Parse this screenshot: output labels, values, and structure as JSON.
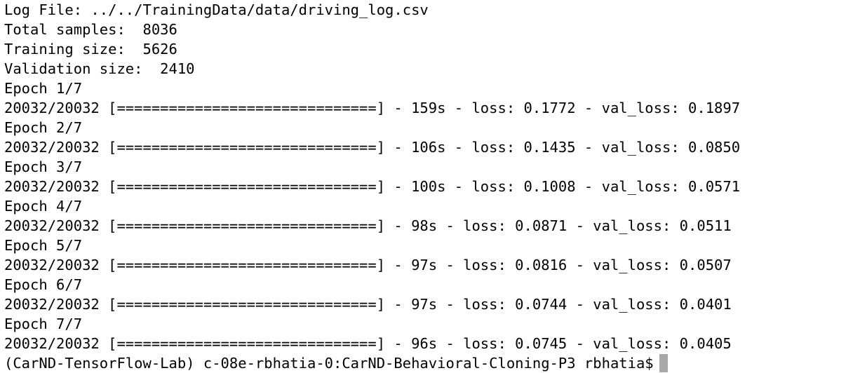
{
  "terminal": {
    "lines": [
      "Log File: ../../TrainingData/data/driving_log.csv",
      "Total samples:  8036",
      "Training size:  5626",
      "Validation size:  2410",
      "Epoch 1/7",
      "20032/20032 [==============================] - 159s - loss: 0.1772 - val_loss: 0.1897",
      "Epoch 2/7",
      "20032/20032 [==============================] - 106s - loss: 0.1435 - val_loss: 0.0850",
      "Epoch 3/7",
      "20032/20032 [==============================] - 100s - loss: 0.1008 - val_loss: 0.0571",
      "Epoch 4/7",
      "20032/20032 [==============================] - 98s - loss: 0.0871 - val_loss: 0.0511",
      "Epoch 5/7",
      "20032/20032 [==============================] - 97s - loss: 0.0816 - val_loss: 0.0507",
      "Epoch 6/7",
      "20032/20032 [==============================] - 97s - loss: 0.0744 - val_loss: 0.0401",
      "Epoch 7/7",
      "20032/20032 [==============================] - 96s - loss: 0.0745 - val_loss: 0.0405"
    ],
    "prompt": "(CarND-TensorFlow-Lab) c-08e-rbhatia-0:CarND-Behavioral-Cloning-P3 rbhatia$",
    "colors": {
      "background": "#ffffff",
      "text": "#000000",
      "cursor": "#a8a8a8"
    }
  }
}
